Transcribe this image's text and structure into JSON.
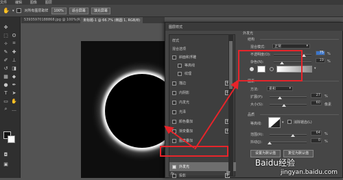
{
  "menubar": {
    "items": [
      "文件",
      "编辑",
      "图像",
      "图层",
      "类型",
      "选择",
      "滤镜",
      "3D",
      "视图",
      "窗口"
    ]
  },
  "optbar": {
    "sample_all": "对所有图层取样",
    "zoom": "100%",
    "fit_screen": "适合屏幕",
    "fill_screen": "填充屏幕"
  },
  "tabs": [
    "53935970188868.jpg @ 100%(RGB/8#)",
    "未标题-1 @ 66.7% (椭圆 1, RGB/8)"
  ],
  "dialog": {
    "title": "图层样式",
    "sidebar": [
      {
        "label": "样式",
        "plus": false,
        "check": false
      },
      {
        "label": "混合选项",
        "plus": false,
        "check": false
      },
      {
        "label": "斜面和浮雕",
        "plus": false,
        "check": true
      },
      {
        "label": "等高线",
        "plus": false,
        "check": true
      },
      {
        "label": "纹理",
        "plus": false,
        "check": true
      },
      {
        "label": "描边",
        "plus": true,
        "check": true
      },
      {
        "label": "内阴影",
        "plus": true,
        "check": true
      },
      {
        "label": "内发光",
        "plus": false,
        "check": true
      },
      {
        "label": "光泽",
        "plus": false,
        "check": true
      },
      {
        "label": "颜色叠加",
        "plus": true,
        "check": true
      },
      {
        "label": "渐变叠加",
        "plus": true,
        "check": true
      },
      {
        "label": "图案叠加",
        "plus": false,
        "check": true
      },
      {
        "label": "外发光",
        "plus": false,
        "check": true,
        "selected": true
      },
      {
        "label": "投影",
        "plus": true,
        "check": true
      }
    ],
    "fx_label": "fx",
    "panel": {
      "section": "外发光",
      "structure": "结构",
      "blend_mode_label": "混合模式:",
      "blend_mode": "正常",
      "opacity_label": "不透明度(O):",
      "opacity": "75",
      "noise_label": "杂色(N):",
      "noise": "19",
      "pct": "%",
      "elements": "图素",
      "method_label": "方法:",
      "method": "柔和",
      "spread_label": "扩展(P):",
      "spread": "27",
      "size_label": "大小(S):",
      "size": "60",
      "px": "像素",
      "quality": "品质",
      "contour_label": "等高线:",
      "antialias": "消除锯齿(L)",
      "range_label": "范围(R):",
      "range": "64",
      "jitter_label": "抖动(J):",
      "jitter": "0",
      "default_btn": "设置为默认值",
      "reset_btn": "复位为默认值"
    }
  },
  "watermark": "jingyan.baidu.com",
  "watermark_logo": "Baidu经验",
  "colors": {
    "accent": "#e8242a",
    "select_blue": "#3b75c9"
  }
}
